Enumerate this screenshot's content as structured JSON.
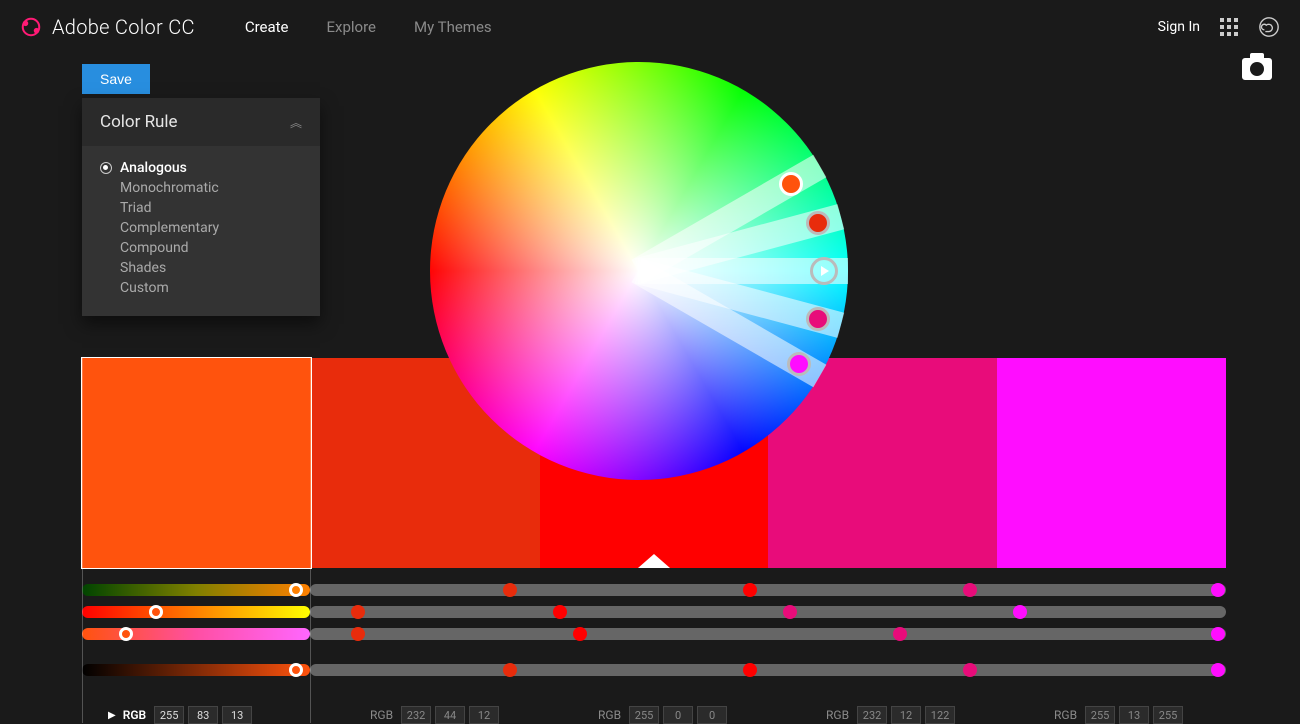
{
  "header": {
    "app_title": "Adobe Color CC",
    "nav": [
      "Create",
      "Explore",
      "My Themes"
    ],
    "active_nav_index": 0,
    "sign_in": "Sign In"
  },
  "save_label": "Save",
  "rule_panel": {
    "title": "Color Rule",
    "options": [
      "Analogous",
      "Monochromatic",
      "Triad",
      "Complementary",
      "Compound",
      "Shades",
      "Custom"
    ],
    "selected_index": 0
  },
  "swatches": [
    {
      "hex": "#FF530D",
      "rgb": [
        255,
        83,
        13
      ],
      "active": true,
      "base": false
    },
    {
      "hex": "#E82C0C",
      "rgb": [
        232,
        44,
        12
      ],
      "active": false,
      "base": false
    },
    {
      "hex": "#FF0000",
      "rgb": [
        255,
        0,
        0
      ],
      "active": false,
      "base": true
    },
    {
      "hex": "#E80C7A",
      "rgb": [
        232,
        12,
        122
      ],
      "active": false,
      "base": false
    },
    {
      "hex": "#FF0DFF",
      "rgb": [
        255,
        13,
        255
      ],
      "active": false,
      "base": false
    }
  ],
  "wheel": {
    "handle_angles_deg": [
      -30,
      -15,
      0,
      15,
      30
    ],
    "handle_colors": [
      "#FF530D",
      "#E82C0C",
      "#FF0000",
      "#E80C7A",
      "#FF0DFF"
    ],
    "base_index": 2,
    "active_index": 0
  },
  "rgb_label": "RGB"
}
